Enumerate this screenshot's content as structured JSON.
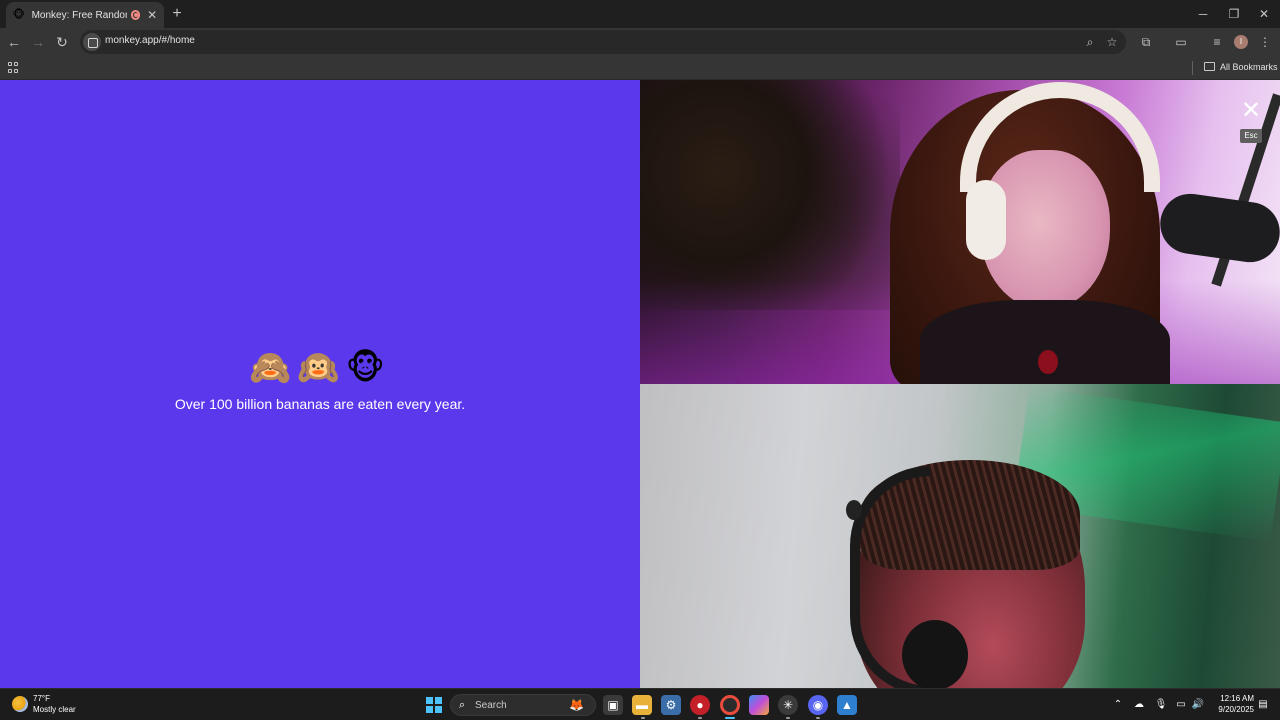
{
  "browser": {
    "tab": {
      "title": "Monkey: Free Random Vide",
      "favicon": "monkey-favicon-icon",
      "close": "✕"
    },
    "new_tab": "+",
    "window_controls": {
      "minimize": "─",
      "restore": "❐",
      "close": "✕"
    },
    "nav": {
      "back": "←",
      "forward": "→",
      "reload": "↻"
    },
    "url": "monkey.app/#/home",
    "omnibox_icons": {
      "zoom": "⌕",
      "star": "☆"
    },
    "toolbar_icons": {
      "extensions": "⧉",
      "media": "▭",
      "queue": "≡",
      "menu": "⋮"
    },
    "profile_initial": "I",
    "bookmarks": {
      "all_label": "All Bookmarks"
    }
  },
  "page": {
    "monkeys": "🙈🙉🐵",
    "fact": "Over 100 billion bananas are eaten every year.",
    "close_button": "✕",
    "esc_hint": "Esc",
    "colors": {
      "left_panel": "#5c38ec"
    }
  },
  "taskbar": {
    "weather": {
      "temp": "77°F",
      "desc": "Mostly clear"
    },
    "search_label": "Search",
    "clock": {
      "time": "12:16 AM",
      "date": "9/20/2025"
    },
    "apps": [
      "task-view",
      "file-explorer",
      "settings",
      "record-app",
      "chrome",
      "copilot",
      "chatgpt",
      "discord",
      "photos"
    ]
  }
}
